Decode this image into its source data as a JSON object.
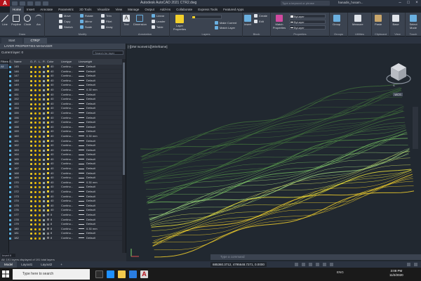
{
  "app": {
    "logo_letter": "A",
    "window_title": "Autodesk AutoCAD 2021   CTR2.dwg",
    "search_placeholder": "Type a keyword or phrase",
    "user_name": "hanadis_hosam..."
  },
  "ribbon_tabs": [
    "Home",
    "Insert",
    "Annotate",
    "Parametric",
    "3D Tools",
    "Visualize",
    "View",
    "Manage",
    "Output",
    "Add-ins",
    "Collaborate",
    "Express Tools",
    "Featured Apps"
  ],
  "ribbon": {
    "draw": {
      "label": "Draw",
      "line": "Line",
      "polyline": "Polyline",
      "circle": "Circle",
      "arc": "Arc"
    },
    "modify": {
      "label": "Modify",
      "move": "Move",
      "rotate": "Rotate",
      "trim": "Trim",
      "copy": "Copy",
      "mirror": "Mirror",
      "fillet": "Fillet",
      "stretch": "Stretch",
      "scale": "Scale",
      "array": "Array"
    },
    "annotation": {
      "label": "Annotation",
      "text": "Text",
      "dimension": "Dimension",
      "linear": "Linear",
      "leader": "Leader",
      "table": "Table"
    },
    "layers": {
      "label": "Layers",
      "layer_properties": "Layer Properties",
      "make_current": "Make Current",
      "match_layer": "Match Layer"
    },
    "block": {
      "label": "Block",
      "insert": "Insert",
      "create": "Create",
      "edit": "Edit"
    },
    "properties": {
      "label": "Properties",
      "match_properties": "Match Properties",
      "bylayer_1": "ByLayer",
      "bylayer_2": "ByLayer",
      "bylayer_3": "ByLayer"
    },
    "groups": {
      "label": "Groups",
      "group": "Group"
    },
    "utilities": {
      "label": "Utilities",
      "measure": "Measure"
    },
    "clipboard": {
      "label": "Clipboard",
      "paste": "Paste"
    },
    "view": {
      "label": "View",
      "base": "Base"
    },
    "touch": {
      "label": "Touch",
      "select_mode": "Select Mode"
    }
  },
  "file_tabs": [
    {
      "label": "Start",
      "active": false
    },
    {
      "label": "CTR2*",
      "active": true
    }
  ],
  "layer_palette": {
    "title": "LAYER PROPERTIES MANAGER",
    "current_layer": "Current layer: 0",
    "search_placeholder": "Search for layer",
    "filters_label": "Filters",
    "filter_all": "All",
    "columns": {
      "s": "S..",
      "name": "Name",
      "o": "O..",
      "f": "F..",
      "l": "L..",
      "p": "P..",
      "color": "Color",
      "linetype": "Linetype",
      "lineweight": "Lineweight"
    },
    "rows": [
      {
        "name": "145",
        "color": "40",
        "linetype": "Continu...",
        "lineweight": "Default"
      },
      {
        "name": "146",
        "color": "40",
        "linetype": "Continu...",
        "lineweight": "Default"
      },
      {
        "name": "147",
        "color": "40",
        "linetype": "Continu...",
        "lineweight": "Default"
      },
      {
        "name": "148",
        "color": "40",
        "linetype": "Continu...",
        "lineweight": "Default"
      },
      {
        "name": "149",
        "color": "40",
        "linetype": "Continu...",
        "lineweight": "Default"
      },
      {
        "name": "150",
        "color": "40",
        "linetype": "Continu...",
        "lineweight": "0.30 mm"
      },
      {
        "name": "151",
        "color": "40",
        "linetype": "Continu...",
        "lineweight": "Default"
      },
      {
        "name": "152",
        "color": "40",
        "linetype": "Continu...",
        "lineweight": "Default"
      },
      {
        "name": "153",
        "color": "40",
        "linetype": "Continu...",
        "lineweight": "Default"
      },
      {
        "name": "154",
        "color": "40",
        "linetype": "Continu...",
        "lineweight": "Default"
      },
      {
        "name": "155",
        "color": "40",
        "linetype": "Continu...",
        "lineweight": "Default"
      },
      {
        "name": "156",
        "color": "40",
        "linetype": "Continu...",
        "lineweight": "Default"
      },
      {
        "name": "157",
        "color": "40",
        "linetype": "Continu...",
        "lineweight": "Default"
      },
      {
        "name": "158",
        "color": "40",
        "linetype": "Continu...",
        "lineweight": "Default"
      },
      {
        "name": "159",
        "color": "40",
        "linetype": "Continu...",
        "lineweight": "Default"
      },
      {
        "name": "160",
        "color": "40",
        "linetype": "Continu...",
        "lineweight": "0.30 mm"
      },
      {
        "name": "161",
        "color": "40",
        "linetype": "Continu...",
        "lineweight": "Default"
      },
      {
        "name": "162",
        "color": "40",
        "linetype": "Continu...",
        "lineweight": "Default"
      },
      {
        "name": "163",
        "color": "40",
        "linetype": "Continu...",
        "lineweight": "Default"
      },
      {
        "name": "164",
        "color": "40",
        "linetype": "Continu...",
        "lineweight": "Default"
      },
      {
        "name": "165",
        "color": "40",
        "linetype": "Continu...",
        "lineweight": "Default"
      },
      {
        "name": "166",
        "color": "40",
        "linetype": "Continu...",
        "lineweight": "Default"
      },
      {
        "name": "167",
        "color": "40",
        "linetype": "Continu...",
        "lineweight": "Default"
      },
      {
        "name": "168",
        "color": "40",
        "linetype": "Continu...",
        "lineweight": "Default"
      },
      {
        "name": "169",
        "color": "40",
        "linetype": "Continu...",
        "lineweight": "Default"
      },
      {
        "name": "170",
        "color": "40",
        "linetype": "Continu...",
        "lineweight": "0.30 mm"
      },
      {
        "name": "171",
        "color": "40",
        "linetype": "Continu...",
        "lineweight": "Default"
      },
      {
        "name": "172",
        "color": "40",
        "linetype": "Continu...",
        "lineweight": "Default"
      },
      {
        "name": "173",
        "color": "40",
        "linetype": "Continu...",
        "lineweight": "Default"
      },
      {
        "name": "174",
        "color": "40",
        "linetype": "Continu...",
        "lineweight": "Default"
      },
      {
        "name": "175",
        "color": "40",
        "linetype": "Continu...",
        "lineweight": "Default"
      },
      {
        "name": "176",
        "color": "40",
        "linetype": "Continu...",
        "lineweight": "Default"
      },
      {
        "name": "177",
        "color": "8",
        "linetype": "Continu...",
        "lineweight": "Default"
      },
      {
        "name": "178",
        "color": "8",
        "linetype": "Continu...",
        "lineweight": "Default"
      },
      {
        "name": "179",
        "color": "8",
        "linetype": "Continu...",
        "lineweight": "Default"
      },
      {
        "name": "180",
        "color": "8",
        "linetype": "Continu...",
        "lineweight": "0.30 mm"
      },
      {
        "name": "181",
        "color": "8",
        "linetype": "Continu...",
        "lineweight": "Default"
      },
      {
        "name": "182",
        "color": "8",
        "linetype": "Continu...",
        "lineweight": "Default"
      }
    ],
    "filter_input": "Invert fi",
    "status": "All: 191 layers displayed of 191 total layers"
  },
  "viewport": {
    "label": "[-][SW Isometric][Wireframe]",
    "viewcube_front": "FRONT",
    "viewcube_compass": "S",
    "wcs": "WCS",
    "command_placeholder": "Type a command"
  },
  "model_tabs": [
    {
      "label": "Model",
      "active": true
    },
    {
      "label": "Layout1",
      "active": false
    },
    {
      "label": "Layout2",
      "active": false
    },
    {
      "label": "+",
      "active": false
    }
  ],
  "status_bar": {
    "coords": "685360.3712, 4795648.7271, 0.0000",
    "model": "MODEL"
  },
  "taskbar": {
    "search_placeholder": "Type here to search",
    "language": "ENG",
    "time": "3:08 PM",
    "date": "11/2/2020"
  },
  "colors": {
    "accent": "#b5121b",
    "layer_yellow": "#f2d02b",
    "contour_green": "#7fd36a",
    "contour_yellow": "#f0e030"
  }
}
